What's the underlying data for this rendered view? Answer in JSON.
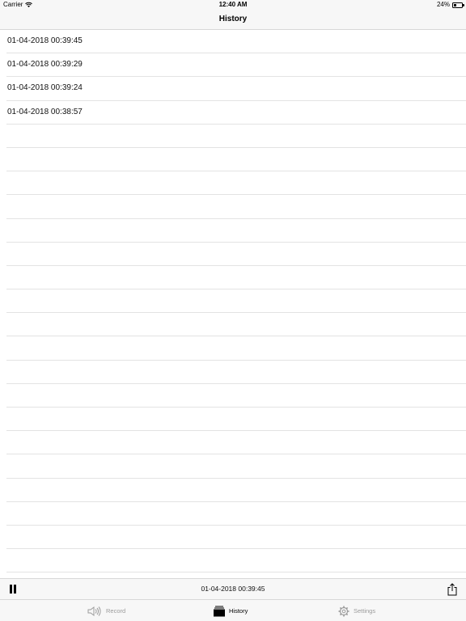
{
  "status_bar": {
    "carrier": "Carrier",
    "time": "12:40 AM",
    "battery": "24%",
    "battery_level": 0.24
  },
  "nav": {
    "title": "History"
  },
  "history": {
    "items": [
      "01-04-2018 00:39:45",
      "01-04-2018 00:39:29",
      "01-04-2018 00:39:24",
      "01-04-2018 00:38:57",
      "",
      "",
      "",
      "",
      "",
      "",
      "",
      "",
      "",
      "",
      "",
      "",
      "",
      "",
      "",
      "",
      "",
      "",
      ""
    ]
  },
  "player": {
    "now_playing": "01-04-2018 00:39:45",
    "pause_icon": "pause-icon",
    "share_icon": "share-icon"
  },
  "tabs": [
    {
      "label": "Record",
      "icon": "speaker-icon",
      "active": false
    },
    {
      "label": "History",
      "icon": "stack-icon",
      "active": true
    },
    {
      "label": "Settings",
      "icon": "gear-icon",
      "active": false
    }
  ],
  "colors": {
    "bar_background": "#f7f7f7",
    "separator": "#e3e3e3",
    "tab_inactive": "#9b9b9b",
    "tab_active": "#000000"
  }
}
